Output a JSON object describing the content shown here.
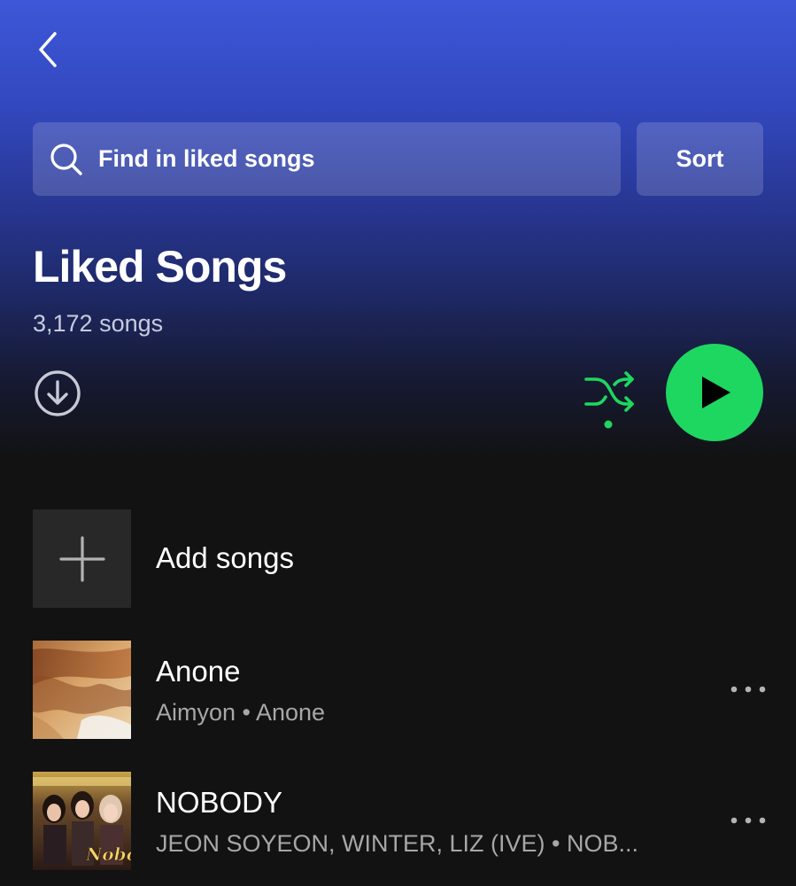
{
  "header": {
    "back_icon": "chevron-left-icon"
  },
  "search": {
    "placeholder": "Find in liked songs",
    "icon": "search-icon"
  },
  "sort": {
    "label": "Sort"
  },
  "playlist": {
    "title": "Liked Songs",
    "count": "3,172 songs"
  },
  "controls": {
    "download_icon": "download-circle-icon",
    "shuffle_icon": "shuffle-icon",
    "play_icon": "play-icon"
  },
  "add_songs": {
    "label": "Add songs",
    "icon": "plus-icon"
  },
  "tracks": [
    {
      "title": "Anone",
      "subtitle": "Aimyon • Anone",
      "cover": "album-cover-anone"
    },
    {
      "title": "NOBODY",
      "subtitle": "JEON SOYEON, WINTER, LIZ (IVE) • NOB...",
      "cover": "album-cover-nobody"
    }
  ],
  "colors": {
    "accent_green": "#1ed760",
    "gradient_top": "#3d57d8",
    "background": "#121212"
  }
}
